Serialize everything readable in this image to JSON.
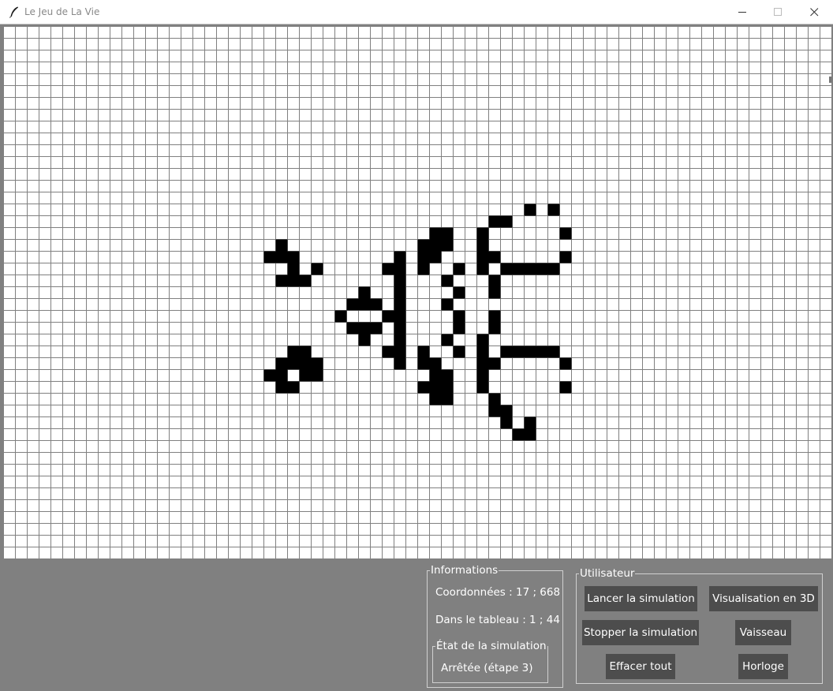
{
  "window": {
    "title": "Le Jeu de La Vie",
    "controls": [
      "minimize",
      "maximize",
      "close"
    ]
  },
  "grid": {
    "columns": 70,
    "rows": 45,
    "live_color": "#000000",
    "dead_color": "#ffffff",
    "line_color": "#808080",
    "live_cells": [
      [
        44,
        15
      ],
      [
        46,
        15
      ],
      [
        41,
        16
      ],
      [
        42,
        16
      ],
      [
        36,
        17
      ],
      [
        37,
        17
      ],
      [
        40,
        17
      ],
      [
        47,
        17
      ],
      [
        23,
        18
      ],
      [
        35,
        18
      ],
      [
        36,
        18
      ],
      [
        37,
        18
      ],
      [
        40,
        18
      ],
      [
        22,
        19
      ],
      [
        23,
        19
      ],
      [
        24,
        19
      ],
      [
        33,
        19
      ],
      [
        35,
        19
      ],
      [
        36,
        19
      ],
      [
        40,
        19
      ],
      [
        41,
        19
      ],
      [
        47,
        19
      ],
      [
        24,
        20
      ],
      [
        26,
        20
      ],
      [
        32,
        20
      ],
      [
        33,
        20
      ],
      [
        35,
        20
      ],
      [
        38,
        20
      ],
      [
        40,
        20
      ],
      [
        42,
        20
      ],
      [
        43,
        20
      ],
      [
        44,
        20
      ],
      [
        45,
        20
      ],
      [
        46,
        20
      ],
      [
        23,
        21
      ],
      [
        24,
        21
      ],
      [
        25,
        21
      ],
      [
        33,
        21
      ],
      [
        37,
        21
      ],
      [
        41,
        21
      ],
      [
        30,
        22
      ],
      [
        33,
        22
      ],
      [
        38,
        22
      ],
      [
        41,
        22
      ],
      [
        29,
        23
      ],
      [
        30,
        23
      ],
      [
        31,
        23
      ],
      [
        33,
        23
      ],
      [
        37,
        23
      ],
      [
        28,
        24
      ],
      [
        32,
        24
      ],
      [
        33,
        24
      ],
      [
        38,
        24
      ],
      [
        41,
        24
      ],
      [
        29,
        25
      ],
      [
        30,
        25
      ],
      [
        31,
        25
      ],
      [
        33,
        25
      ],
      [
        38,
        25
      ],
      [
        41,
        25
      ],
      [
        30,
        26
      ],
      [
        33,
        26
      ],
      [
        37,
        26
      ],
      [
        40,
        26
      ],
      [
        24,
        27
      ],
      [
        25,
        27
      ],
      [
        32,
        27
      ],
      [
        33,
        27
      ],
      [
        35,
        27
      ],
      [
        38,
        27
      ],
      [
        40,
        27
      ],
      [
        42,
        27
      ],
      [
        43,
        27
      ],
      [
        44,
        27
      ],
      [
        45,
        27
      ],
      [
        46,
        27
      ],
      [
        23,
        28
      ],
      [
        24,
        28
      ],
      [
        25,
        28
      ],
      [
        26,
        28
      ],
      [
        33,
        28
      ],
      [
        35,
        28
      ],
      [
        36,
        28
      ],
      [
        40,
        28
      ],
      [
        41,
        28
      ],
      [
        47,
        28
      ],
      [
        22,
        29
      ],
      [
        23,
        29
      ],
      [
        25,
        29
      ],
      [
        26,
        29
      ],
      [
        36,
        29
      ],
      [
        37,
        29
      ],
      [
        40,
        29
      ],
      [
        23,
        30
      ],
      [
        24,
        30
      ],
      [
        35,
        30
      ],
      [
        36,
        30
      ],
      [
        37,
        30
      ],
      [
        40,
        30
      ],
      [
        47,
        30
      ],
      [
        36,
        31
      ],
      [
        37,
        31
      ],
      [
        41,
        31
      ],
      [
        41,
        32
      ],
      [
        42,
        32
      ],
      [
        42,
        33
      ],
      [
        44,
        33
      ],
      [
        43,
        34
      ],
      [
        44,
        34
      ]
    ]
  },
  "info": {
    "legend": "Informations",
    "coordinates": "Coordonnées : 17 ; 668",
    "table_position": "Dans le tableau : 1 ; 44",
    "state_legend": "État de la simulation",
    "state_value": "Arrêtée (étape 3)"
  },
  "user": {
    "legend": "Utilisateur",
    "buttons": {
      "start": "Lancer la simulation",
      "view3d": "Visualisation en 3D",
      "stop": "Stopper la simulation",
      "ship": "Vaisseau",
      "clear": "Effacer tout",
      "clock": "Horloge"
    },
    "button_color": "#4d4d4d",
    "panel_color": "#808080"
  },
  "icons": [
    "feather-icon",
    "minimize-icon",
    "maximize-icon",
    "close-icon"
  ]
}
